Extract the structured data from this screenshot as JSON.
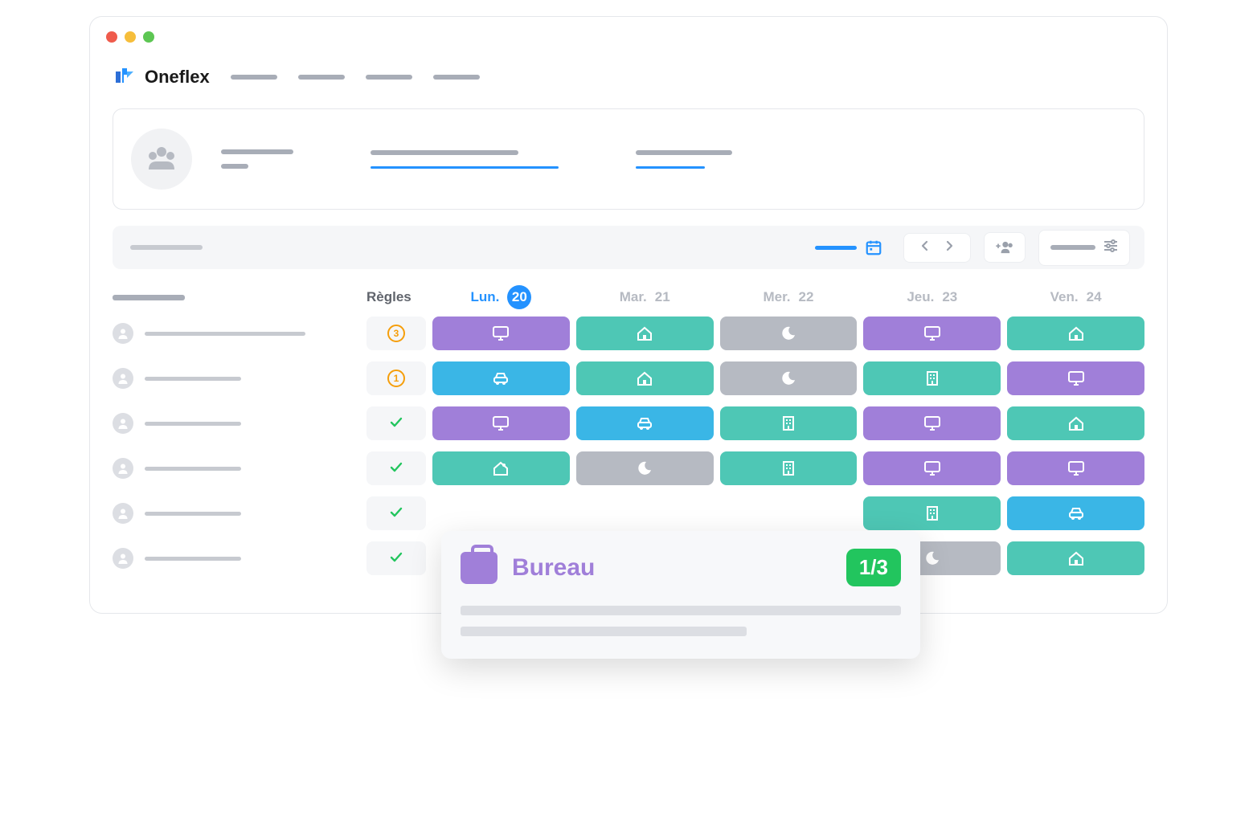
{
  "app": {
    "name": "Oneflex"
  },
  "colors": {
    "accent": "#2492ff",
    "purple": "#a07fd9",
    "teal": "#4ec7b5",
    "gray": "#b6bac2",
    "blue": "#3ab6e6",
    "success": "#22c55e",
    "warning": "#f59e0b"
  },
  "planning": {
    "rules_label": "Règles",
    "days": [
      {
        "label": "Lun.",
        "num": "20",
        "active": true
      },
      {
        "label": "Mar.",
        "num": "21",
        "active": false
      },
      {
        "label": "Mer.",
        "num": "22",
        "active": false
      },
      {
        "label": "Jeu.",
        "num": "23",
        "active": false
      },
      {
        "label": "Ven.",
        "num": "24",
        "active": false
      }
    ],
    "rows": [
      {
        "rule": {
          "type": "badge",
          "value": "3"
        },
        "cells": [
          "purple-office",
          "teal-remote",
          "gray-off",
          "purple-office",
          "teal-remote"
        ]
      },
      {
        "rule": {
          "type": "badge",
          "value": "1"
        },
        "cells": [
          "blue-travel",
          "teal-remote",
          "gray-off",
          "teal-building",
          "purple-office"
        ]
      },
      {
        "rule": {
          "type": "check"
        },
        "cells": [
          "purple-office",
          "blue-travel",
          "teal-building",
          "purple-office",
          "teal-remote"
        ]
      },
      {
        "rule": {
          "type": "check"
        },
        "cells": [
          "teal-remote2",
          "gray-off",
          "teal-building",
          "purple-office",
          "purple-office"
        ]
      },
      {
        "rule": {
          "type": "check"
        },
        "cells": [
          "",
          "",
          "",
          "teal-building",
          "blue-travel"
        ]
      },
      {
        "rule": {
          "type": "check"
        },
        "cells": [
          "",
          "",
          "",
          "gray-off",
          "teal-remote"
        ]
      }
    ]
  },
  "popover": {
    "title": "Bureau",
    "count": "1/3"
  },
  "icons": {
    "office": "monitor",
    "remote": "home",
    "off": "moon",
    "travel": "car",
    "building": "building"
  }
}
